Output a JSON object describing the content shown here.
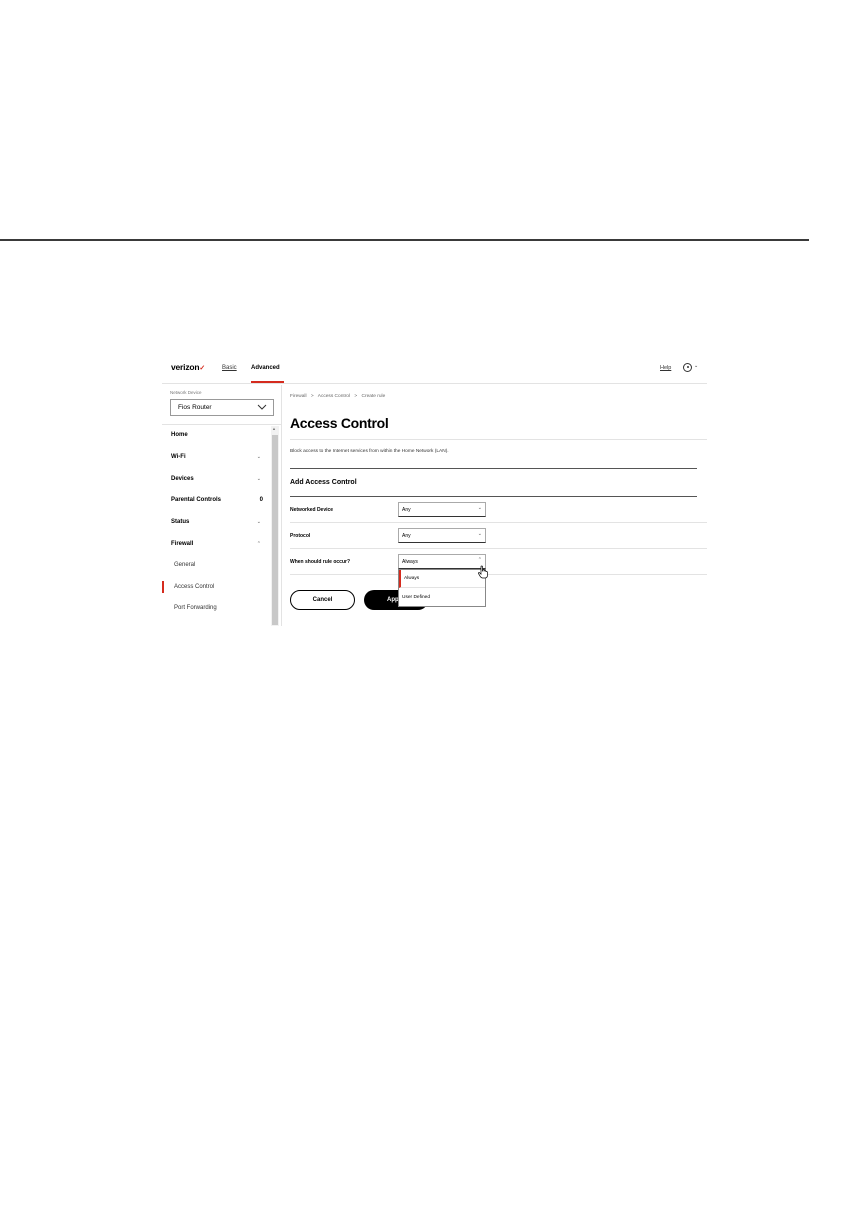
{
  "header": {
    "logo": "verizon",
    "logo_mark": "✓",
    "tabs": [
      {
        "label": "Basic"
      },
      {
        "label": "Advanced",
        "active": true
      }
    ],
    "help_label": "Help",
    "user_chevron": "⌄"
  },
  "sidebar": {
    "network_device_label": "Network Device",
    "network_device_value": "Fios Router",
    "items": [
      {
        "label": "Home",
        "chevron": ""
      },
      {
        "label": "Wi-Fi",
        "chevron": "⌄"
      },
      {
        "label": "Devices",
        "chevron": "⌄"
      },
      {
        "label": "Parental Controls",
        "badge": "0"
      },
      {
        "label": "Status",
        "chevron": "⌄"
      },
      {
        "label": "Firewall",
        "chevron": "⌃"
      }
    ],
    "sub_items": [
      {
        "label": "General"
      },
      {
        "label": "Access Control",
        "active": true
      },
      {
        "label": "Port Forwarding"
      }
    ]
  },
  "main": {
    "breadcrumb": [
      "Firewall",
      ">",
      "Access Control",
      ">",
      "Create rule"
    ],
    "title": "Access Control",
    "description": "Block access to the Internet services from within the Home Network (LAN).",
    "section_title": "Add Access Control",
    "rows": [
      {
        "label": "Networked Device",
        "value": "Any",
        "chevron": "⌄"
      },
      {
        "label": "Protocol",
        "value": "Any",
        "chevron": "⌄"
      },
      {
        "label": "When should rule occur?",
        "value": "Always",
        "chevron": "⌃"
      }
    ],
    "dropdown_options": [
      {
        "label": "Always",
        "selected": true
      },
      {
        "label": "User Defined"
      }
    ],
    "cancel_label": "Cancel",
    "apply_label": "Apply"
  },
  "colors": {
    "accent": "#d52b1e"
  }
}
